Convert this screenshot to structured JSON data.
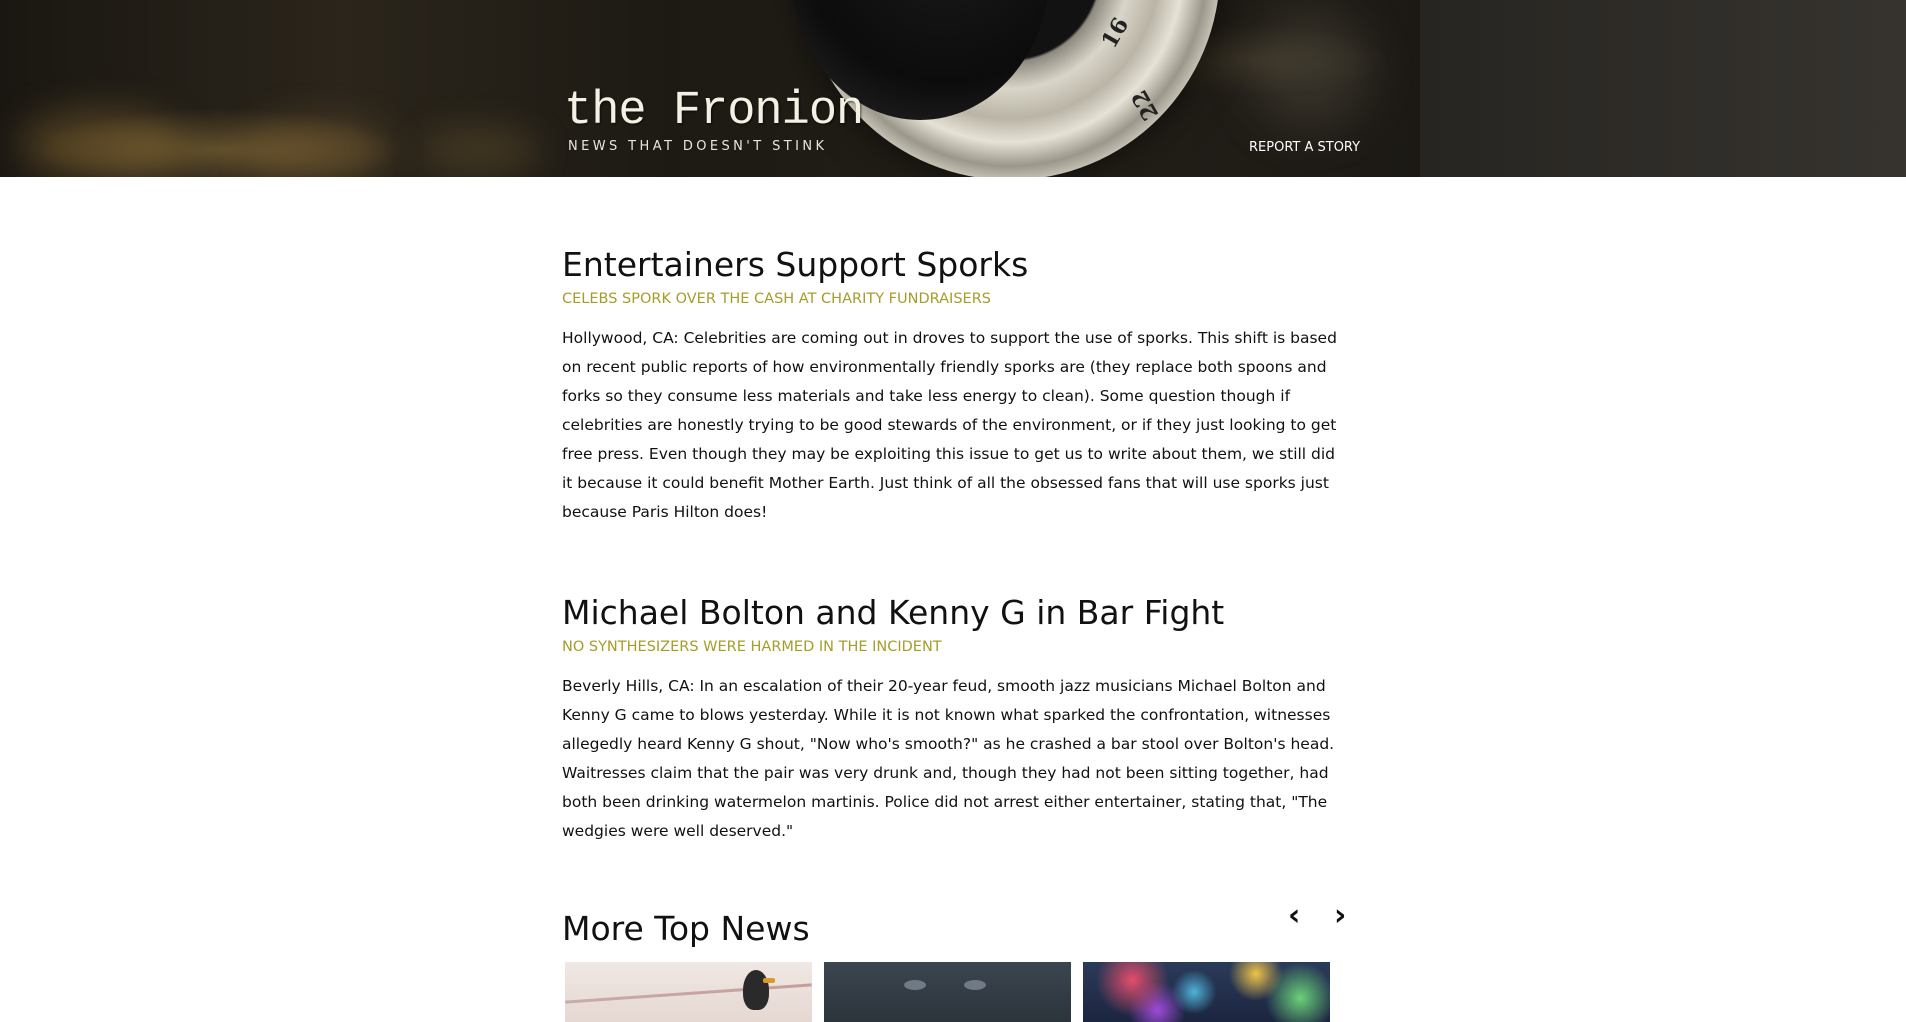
{
  "header": {
    "site_name": "the Fronion",
    "tagline": "NEWS THAT DOESN'T STINK",
    "report_link": "REPORT A STORY",
    "lens_marking_1": "16",
    "lens_marking_2": "22"
  },
  "articles": [
    {
      "title": "Entertainers Support Sporks",
      "subtitle": "CELEBS SPORK OVER THE CASH AT CHARITY FUNDRAISERS",
      "body": "Hollywood, CA: Celebrities are coming out in droves to support the use of sporks. This shift is based on recent public reports of how environmentally friendly sporks are (they replace both spoons and forks so they consume less materials and take less energy to clean). Some question though if celebrities are honestly trying to be good stewards of the environment, or if they just looking to get free press. Even though they may be exploiting this issue to get us to write about them, we still did it because it could benefit Mother Earth. Just think of all the obsessed fans that will use sporks just because Paris Hilton does!"
    },
    {
      "title": "Michael Bolton and Kenny G in Bar Fight",
      "subtitle": "NO SYNTHESIZERS WERE HARMED IN THE INCIDENT",
      "body": "Beverly Hills, CA: In an escalation of their 20-year feud, smooth jazz musicians Michael Bolton and Kenny G came to blows yesterday. While it is not known what sparked the confrontation, witnesses allegedly heard Kenny G shout, \"Now who's smooth?\" as he crashed a bar stool over Bolton's head. Waitresses claim that the pair was very drunk and, though they had not been sitting together, had both been drinking watermelon martinis. Police did not arrest either entertainer, stating that, \"The wedgies were well deserved.\""
    }
  ],
  "more_news": {
    "title": "More Top News",
    "prev_label": "‹",
    "next_label": "›"
  },
  "colors": {
    "subtitle": "#a69d28",
    "text": "#111111"
  }
}
